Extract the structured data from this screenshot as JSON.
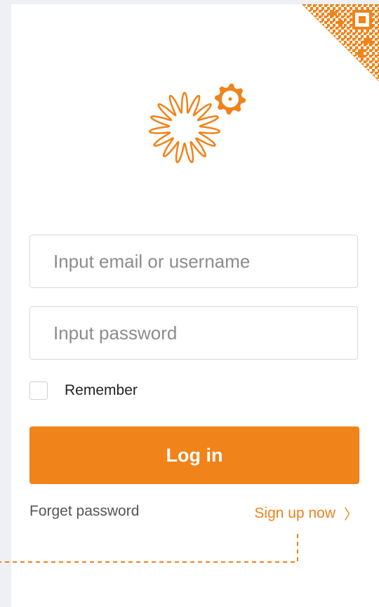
{
  "login": {
    "username_placeholder": "Input email or username",
    "password_placeholder": "Input password",
    "remember_label": "Remember",
    "remember_checked": false,
    "submit_label": "Log in",
    "forgot_label": "Forget password",
    "signup_label": "Sign up now",
    "signup_chevron": "〉"
  },
  "icons": {
    "logo": "gear-sun-logo-icon",
    "qr": "qr-code-corner-icon",
    "signup_arrow": "chevron-right-icon"
  },
  "colors": {
    "accent": "#f0831a",
    "page_background": "#eef0f3",
    "card_background": "#ffffff",
    "input_border": "#d9d9d9",
    "placeholder_text": "#8c8c8c",
    "secondary_link": "#555555"
  }
}
